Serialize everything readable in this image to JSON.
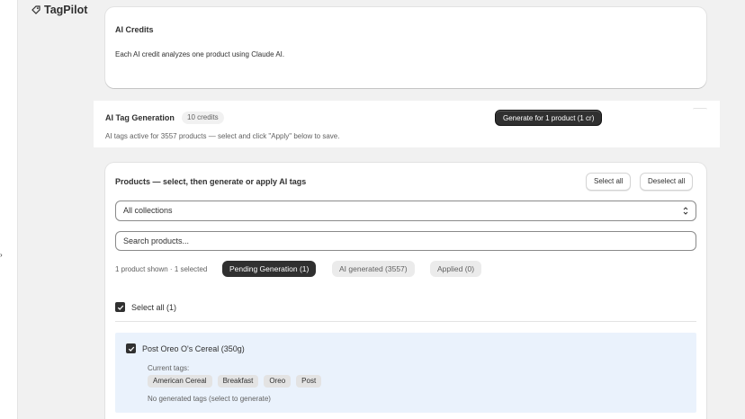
{
  "app": {
    "title": "TagPilot",
    "rail_handle": "›"
  },
  "credits_card": {
    "title": "AI Credits",
    "description": "Each AI credit analyzes one product using Claude AI."
  },
  "tag_generation": {
    "title": "AI Tag Generation",
    "credits_badge": "10 credits",
    "generate_button": "Generate for 1 product (1 cr)",
    "note": "AI tags active for 3557 products — select and click \"Apply\" below to save."
  },
  "products": {
    "title": "Products — select, then generate or apply AI tags",
    "select_all_button": "Select all",
    "deselect_all_button": "Deselect all",
    "collection_select": {
      "value": "All collections"
    },
    "search": {
      "placeholder": "Search products..."
    },
    "shown_count": "1 product shown · 1 selected",
    "filters": [
      {
        "label": "Pending Generation (1)",
        "active": true
      },
      {
        "label": "AI generated (3557)",
        "active": false
      },
      {
        "label": "Applied (0)",
        "active": false
      }
    ],
    "select_all_checkbox": {
      "label": "Select all (1)",
      "checked": true
    },
    "items": [
      {
        "name": "Post Oreo O's Cereal (350g)",
        "checked": true,
        "current_tags_label": "Current tags:",
        "tags": [
          "American Cereal",
          "Breakfast",
          "Oreo",
          "Post"
        ],
        "generated_note": "No generated tags (select to generate)"
      }
    ]
  },
  "colors": {
    "primary_button": "#303030",
    "selected_row": "#eaf2fc",
    "page_bg": "#f1f1f1"
  },
  "icons": {
    "app": "tag-icon",
    "select": "chevron-up-down-icon",
    "checkbox": "checkmark-icon"
  }
}
